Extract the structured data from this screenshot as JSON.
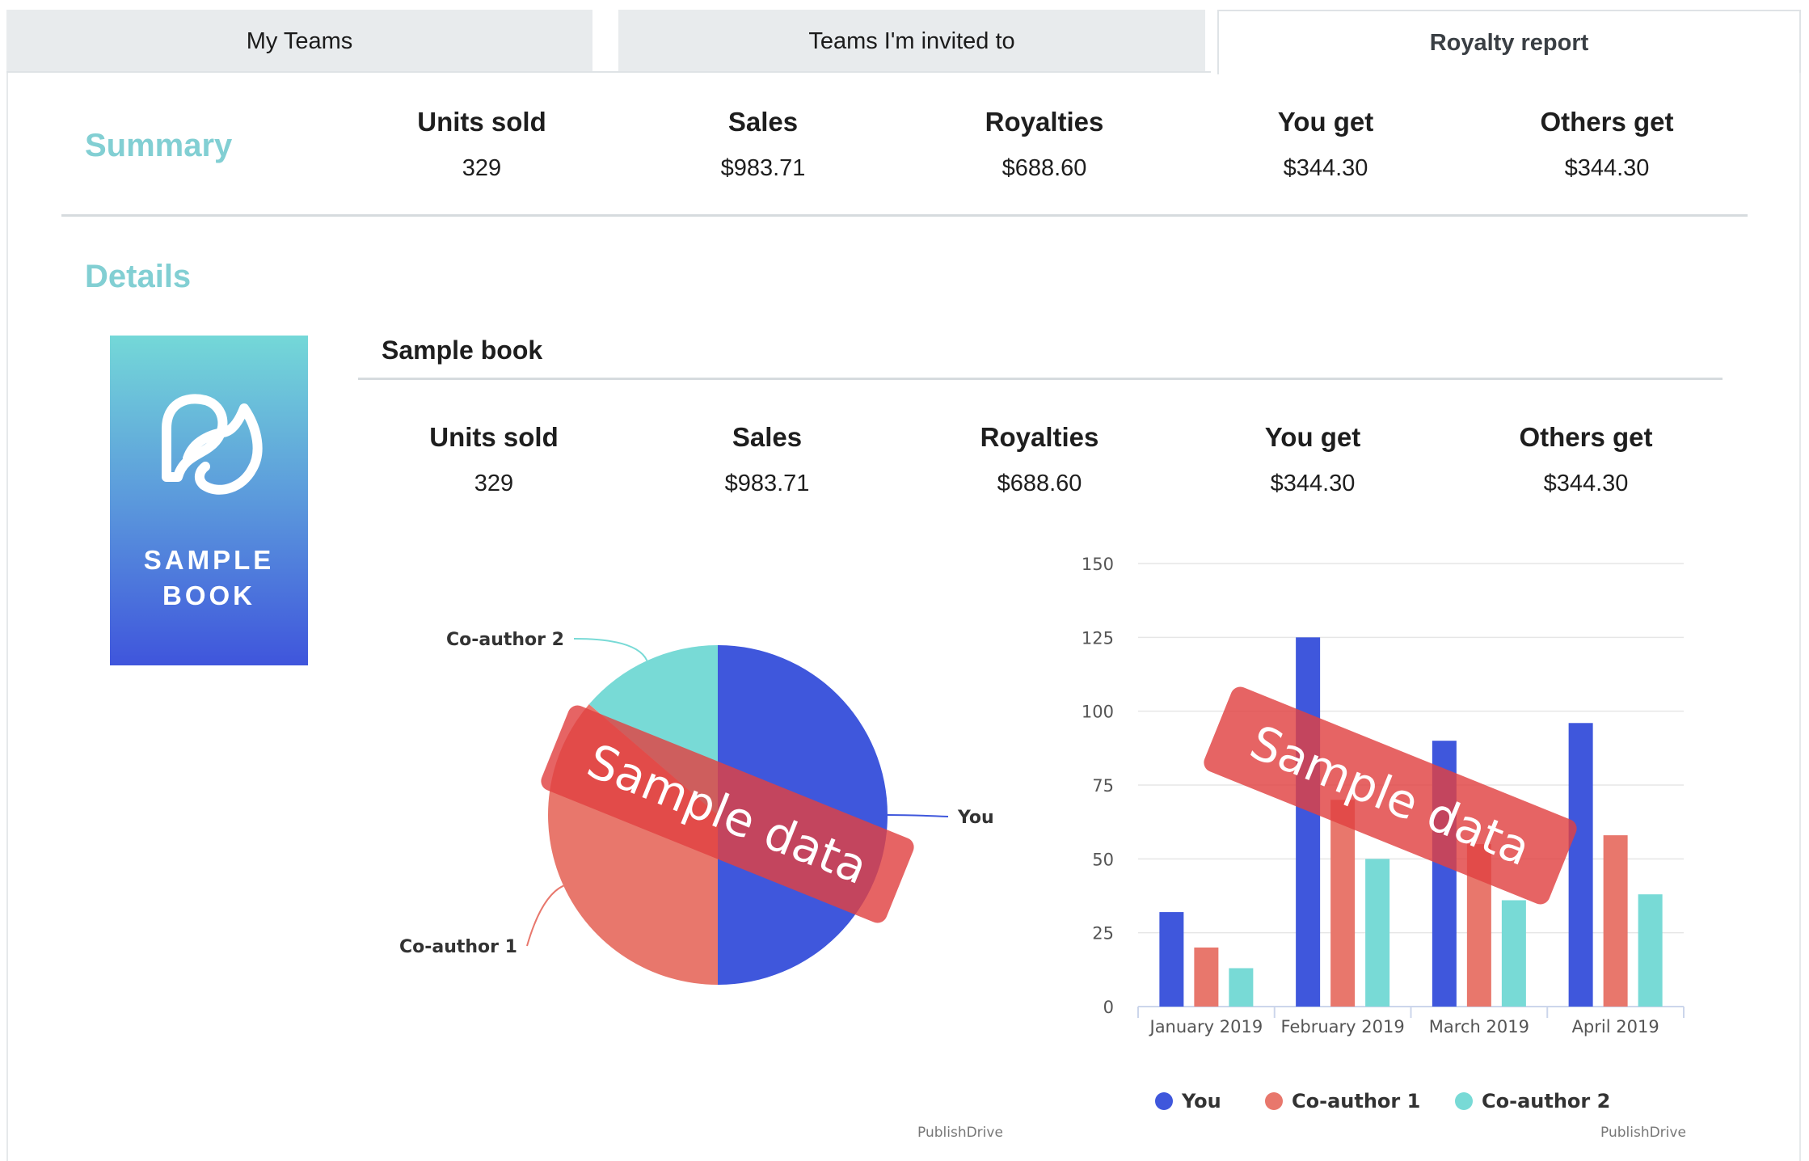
{
  "tabs": [
    {
      "label": "My Teams"
    },
    {
      "label": "Teams I'm invited to"
    },
    {
      "label": "Royalty report"
    }
  ],
  "summary": {
    "title": "Summary",
    "stats": [
      {
        "label": "Units sold",
        "value": "329"
      },
      {
        "label": "Sales",
        "value": "$983.71"
      },
      {
        "label": "Royalties",
        "value": "$688.60"
      },
      {
        "label": "You get",
        "value": "$344.30"
      },
      {
        "label": "Others get",
        "value": "$344.30"
      }
    ]
  },
  "details": {
    "title": "Details",
    "cover": {
      "line1": "SAMPLE",
      "line2": "BOOK",
      "gradient_top": "#74d8d8",
      "gradient_bottom": "#3f55dc"
    },
    "book_title": "Sample book",
    "stats": [
      {
        "label": "Units sold",
        "value": "329"
      },
      {
        "label": "Sales",
        "value": "$983.71"
      },
      {
        "label": "Royalties",
        "value": "$688.60"
      },
      {
        "label": "You get",
        "value": "$344.30"
      },
      {
        "label": "Others get",
        "value": "$344.30"
      }
    ]
  },
  "watermark": "Sample data",
  "credit": "PublishDrive",
  "colors": {
    "you": "#3f57dc",
    "coauthor1": "#e8776c",
    "coauthor2": "#78dad6",
    "accent": "#82cfd3"
  },
  "chart_data": [
    {
      "type": "pie",
      "labels": [
        "You",
        "Co-author 1",
        "Co-author 2"
      ],
      "values": [
        344.3,
        250.0,
        94.3
      ]
    },
    {
      "type": "bar",
      "categories": [
        "January 2019",
        "February 2019",
        "March 2019",
        "April 2019"
      ],
      "ylim": [
        0,
        150
      ],
      "yticks": [
        0,
        25,
        50,
        75,
        100,
        125,
        150
      ],
      "legend": "bottom",
      "grid": true,
      "series": [
        {
          "name": "You",
          "values": [
            32,
            125,
            90,
            96
          ]
        },
        {
          "name": "Co-author 1",
          "values": [
            20,
            70,
            55,
            58
          ]
        },
        {
          "name": "Co-author 2",
          "values": [
            13,
            50,
            36,
            38
          ]
        }
      ]
    }
  ]
}
